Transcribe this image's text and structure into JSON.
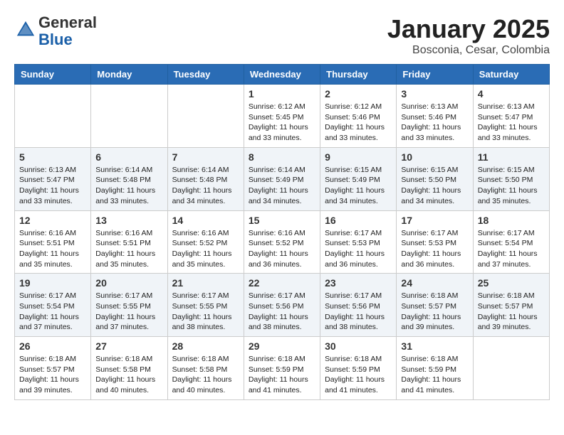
{
  "header": {
    "logo_line1": "General",
    "logo_line2": "Blue",
    "month": "January 2025",
    "location": "Bosconia, Cesar, Colombia"
  },
  "days_of_week": [
    "Sunday",
    "Monday",
    "Tuesday",
    "Wednesday",
    "Thursday",
    "Friday",
    "Saturday"
  ],
  "weeks": [
    [
      {
        "day": "",
        "info": ""
      },
      {
        "day": "",
        "info": ""
      },
      {
        "day": "",
        "info": ""
      },
      {
        "day": "1",
        "info": "Sunrise: 6:12 AM\nSunset: 5:45 PM\nDaylight: 11 hours\nand 33 minutes."
      },
      {
        "day": "2",
        "info": "Sunrise: 6:12 AM\nSunset: 5:46 PM\nDaylight: 11 hours\nand 33 minutes."
      },
      {
        "day": "3",
        "info": "Sunrise: 6:13 AM\nSunset: 5:46 PM\nDaylight: 11 hours\nand 33 minutes."
      },
      {
        "day": "4",
        "info": "Sunrise: 6:13 AM\nSunset: 5:47 PM\nDaylight: 11 hours\nand 33 minutes."
      }
    ],
    [
      {
        "day": "5",
        "info": "Sunrise: 6:13 AM\nSunset: 5:47 PM\nDaylight: 11 hours\nand 33 minutes."
      },
      {
        "day": "6",
        "info": "Sunrise: 6:14 AM\nSunset: 5:48 PM\nDaylight: 11 hours\nand 33 minutes."
      },
      {
        "day": "7",
        "info": "Sunrise: 6:14 AM\nSunset: 5:48 PM\nDaylight: 11 hours\nand 34 minutes."
      },
      {
        "day": "8",
        "info": "Sunrise: 6:14 AM\nSunset: 5:49 PM\nDaylight: 11 hours\nand 34 minutes."
      },
      {
        "day": "9",
        "info": "Sunrise: 6:15 AM\nSunset: 5:49 PM\nDaylight: 11 hours\nand 34 minutes."
      },
      {
        "day": "10",
        "info": "Sunrise: 6:15 AM\nSunset: 5:50 PM\nDaylight: 11 hours\nand 34 minutes."
      },
      {
        "day": "11",
        "info": "Sunrise: 6:15 AM\nSunset: 5:50 PM\nDaylight: 11 hours\nand 35 minutes."
      }
    ],
    [
      {
        "day": "12",
        "info": "Sunrise: 6:16 AM\nSunset: 5:51 PM\nDaylight: 11 hours\nand 35 minutes."
      },
      {
        "day": "13",
        "info": "Sunrise: 6:16 AM\nSunset: 5:51 PM\nDaylight: 11 hours\nand 35 minutes."
      },
      {
        "day": "14",
        "info": "Sunrise: 6:16 AM\nSunset: 5:52 PM\nDaylight: 11 hours\nand 35 minutes."
      },
      {
        "day": "15",
        "info": "Sunrise: 6:16 AM\nSunset: 5:52 PM\nDaylight: 11 hours\nand 36 minutes."
      },
      {
        "day": "16",
        "info": "Sunrise: 6:17 AM\nSunset: 5:53 PM\nDaylight: 11 hours\nand 36 minutes."
      },
      {
        "day": "17",
        "info": "Sunrise: 6:17 AM\nSunset: 5:53 PM\nDaylight: 11 hours\nand 36 minutes."
      },
      {
        "day": "18",
        "info": "Sunrise: 6:17 AM\nSunset: 5:54 PM\nDaylight: 11 hours\nand 37 minutes."
      }
    ],
    [
      {
        "day": "19",
        "info": "Sunrise: 6:17 AM\nSunset: 5:54 PM\nDaylight: 11 hours\nand 37 minutes."
      },
      {
        "day": "20",
        "info": "Sunrise: 6:17 AM\nSunset: 5:55 PM\nDaylight: 11 hours\nand 37 minutes."
      },
      {
        "day": "21",
        "info": "Sunrise: 6:17 AM\nSunset: 5:55 PM\nDaylight: 11 hours\nand 38 minutes."
      },
      {
        "day": "22",
        "info": "Sunrise: 6:17 AM\nSunset: 5:56 PM\nDaylight: 11 hours\nand 38 minutes."
      },
      {
        "day": "23",
        "info": "Sunrise: 6:17 AM\nSunset: 5:56 PM\nDaylight: 11 hours\nand 38 minutes."
      },
      {
        "day": "24",
        "info": "Sunrise: 6:18 AM\nSunset: 5:57 PM\nDaylight: 11 hours\nand 39 minutes."
      },
      {
        "day": "25",
        "info": "Sunrise: 6:18 AM\nSunset: 5:57 PM\nDaylight: 11 hours\nand 39 minutes."
      }
    ],
    [
      {
        "day": "26",
        "info": "Sunrise: 6:18 AM\nSunset: 5:57 PM\nDaylight: 11 hours\nand 39 minutes."
      },
      {
        "day": "27",
        "info": "Sunrise: 6:18 AM\nSunset: 5:58 PM\nDaylight: 11 hours\nand 40 minutes."
      },
      {
        "day": "28",
        "info": "Sunrise: 6:18 AM\nSunset: 5:58 PM\nDaylight: 11 hours\nand 40 minutes."
      },
      {
        "day": "29",
        "info": "Sunrise: 6:18 AM\nSunset: 5:59 PM\nDaylight: 11 hours\nand 41 minutes."
      },
      {
        "day": "30",
        "info": "Sunrise: 6:18 AM\nSunset: 5:59 PM\nDaylight: 11 hours\nand 41 minutes."
      },
      {
        "day": "31",
        "info": "Sunrise: 6:18 AM\nSunset: 5:59 PM\nDaylight: 11 hours\nand 41 minutes."
      },
      {
        "day": "",
        "info": ""
      }
    ]
  ]
}
